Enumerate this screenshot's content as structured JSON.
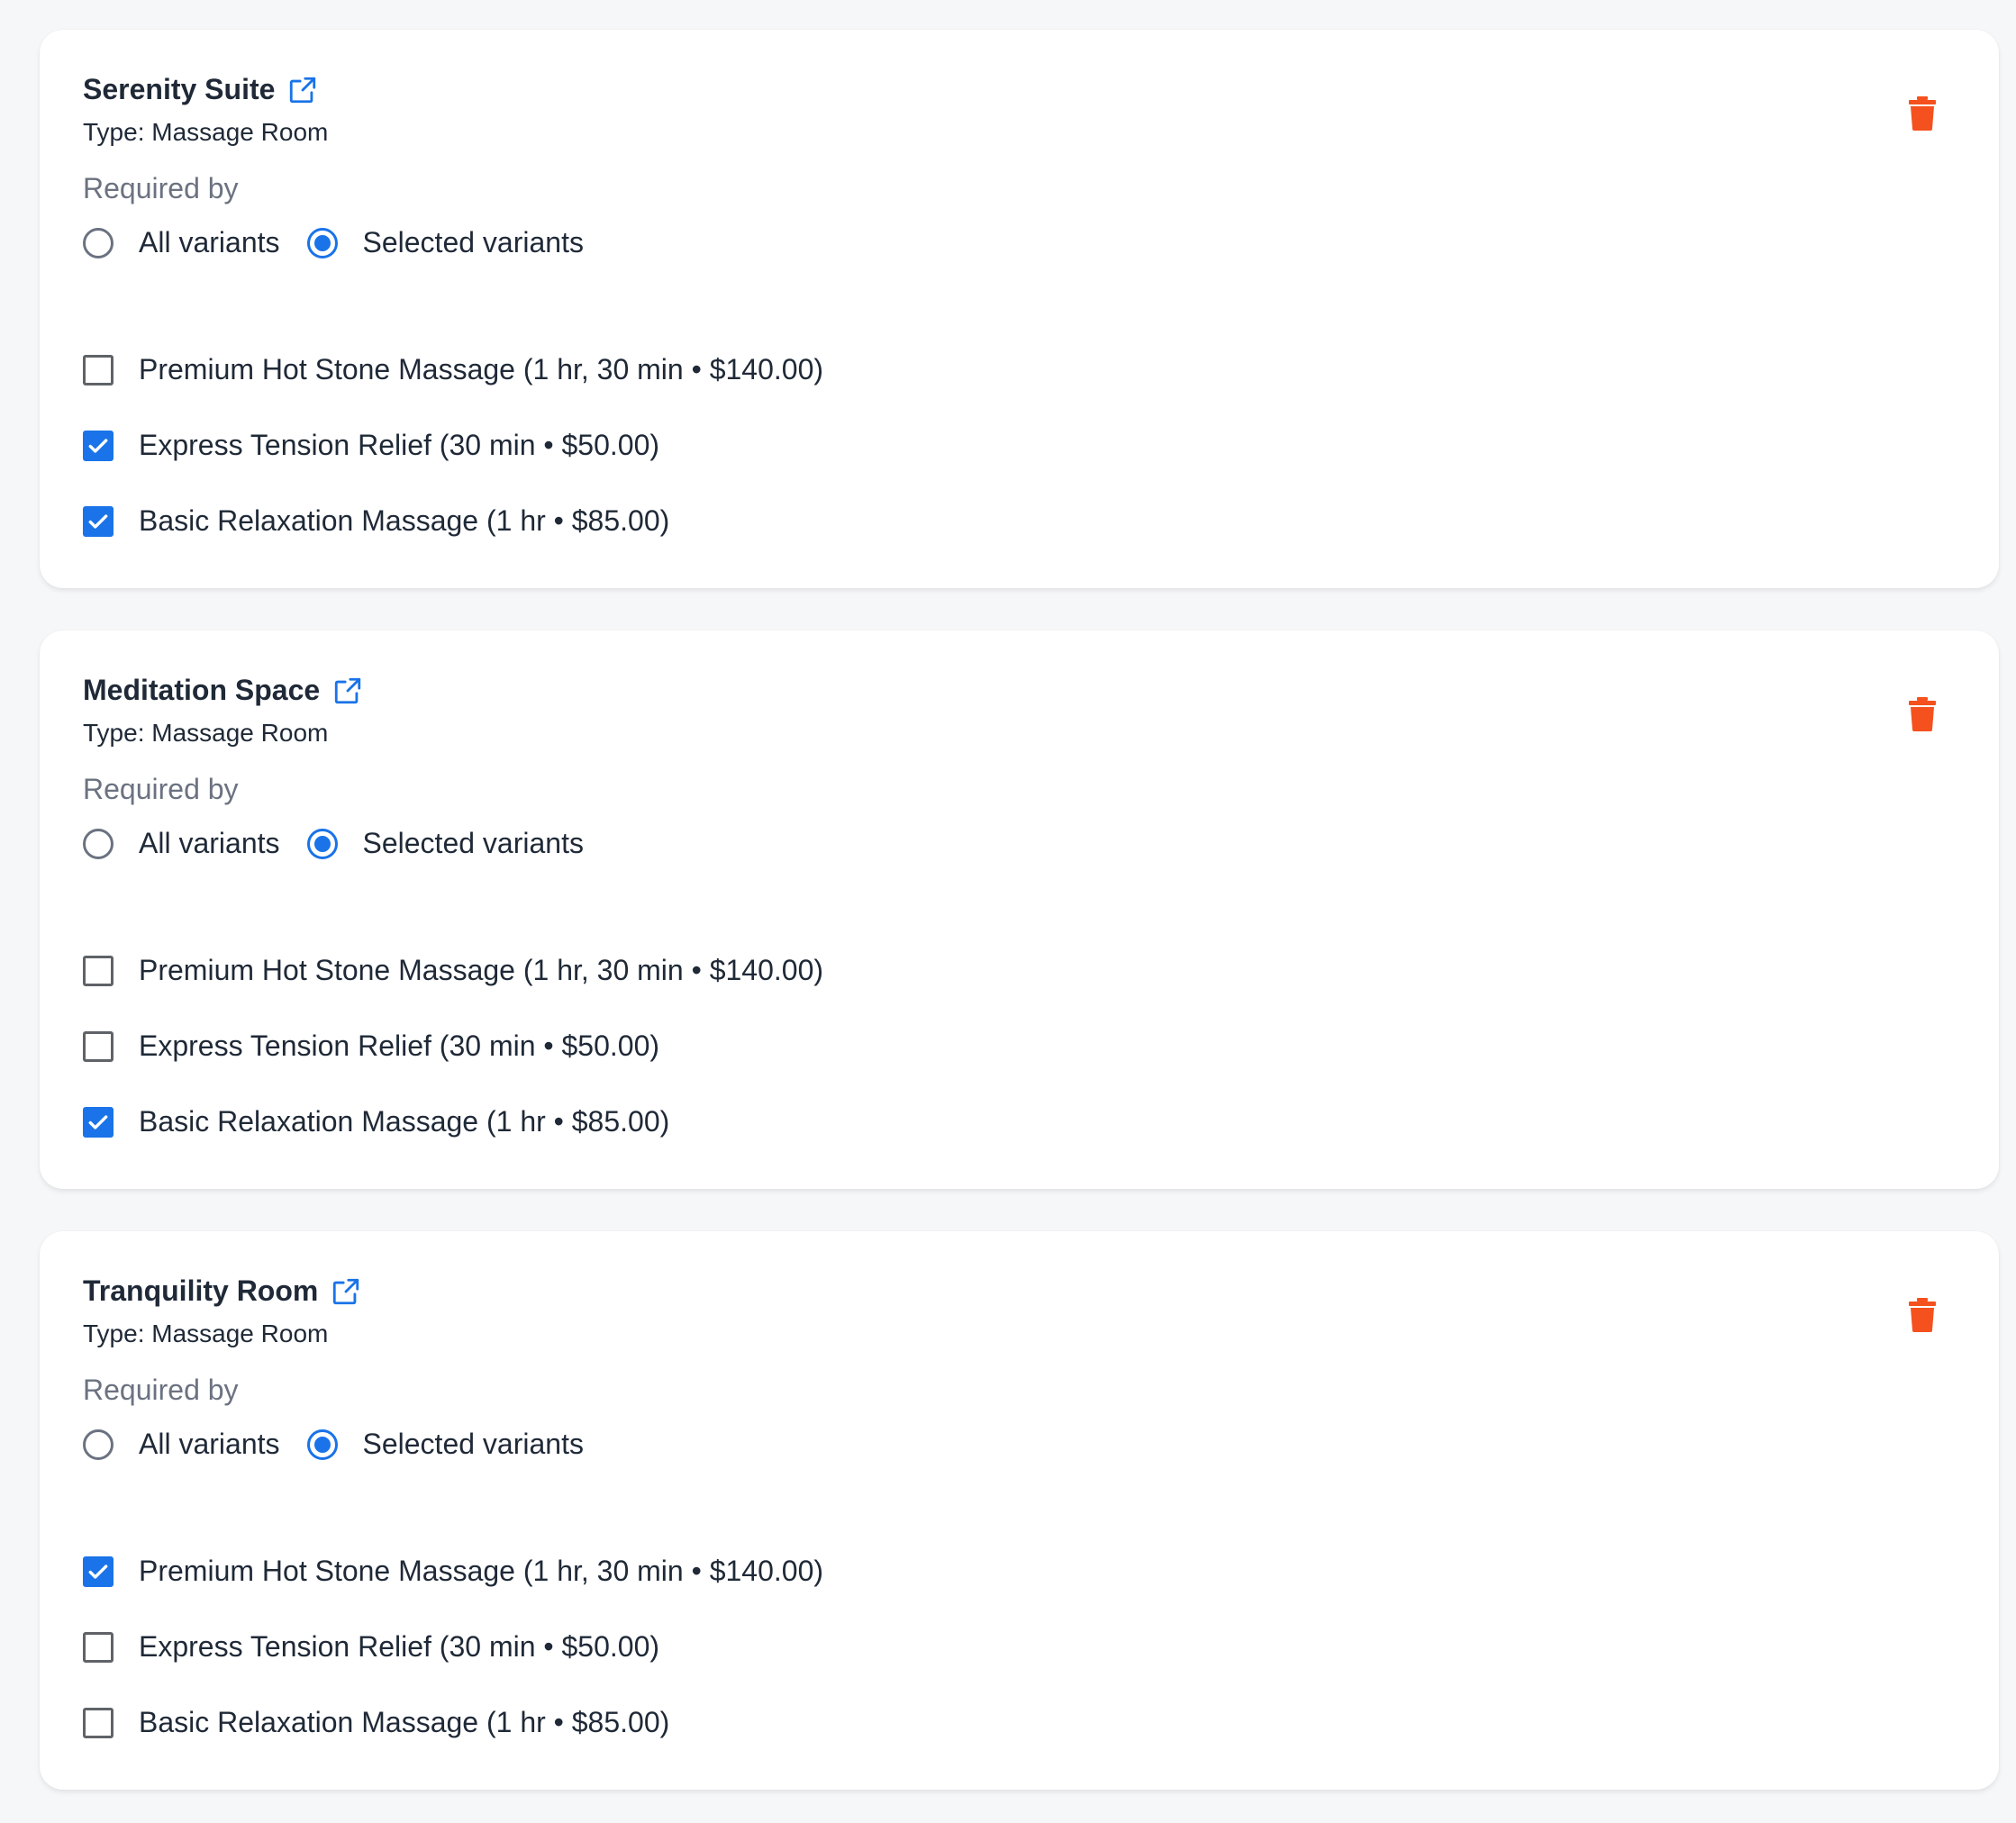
{
  "colors": {
    "accent": "#1a73e8",
    "delete": "#f4511e",
    "muted_text": "#6b7280",
    "text": "#1f2937"
  },
  "icons": {
    "open_link": "external-link-icon",
    "delete": "trash-icon"
  },
  "resources": [
    {
      "name": "Serenity Suite",
      "type_text": "Type: Massage Room",
      "required_by_label": "Required by",
      "radio_all": "All variants",
      "radio_selected": "Selected variants",
      "selected_option": "selected",
      "variants": [
        {
          "label": "Premium Hot Stone Massage (1 hr, 30 min • $140.00)",
          "checked": false
        },
        {
          "label": "Express Tension Relief (30 min • $50.00)",
          "checked": true
        },
        {
          "label": "Basic Relaxation Massage (1 hr • $85.00)",
          "checked": true
        }
      ]
    },
    {
      "name": "Meditation Space",
      "type_text": "Type: Massage Room",
      "required_by_label": "Required by",
      "radio_all": "All variants",
      "radio_selected": "Selected variants",
      "selected_option": "selected",
      "variants": [
        {
          "label": "Premium Hot Stone Massage (1 hr, 30 min • $140.00)",
          "checked": false
        },
        {
          "label": "Express Tension Relief (30 min • $50.00)",
          "checked": false
        },
        {
          "label": "Basic Relaxation Massage (1 hr • $85.00)",
          "checked": true
        }
      ]
    },
    {
      "name": "Tranquility Room",
      "type_text": "Type: Massage Room",
      "required_by_label": "Required by",
      "radio_all": "All variants",
      "radio_selected": "Selected variants",
      "selected_option": "selected",
      "variants": [
        {
          "label": "Premium Hot Stone Massage (1 hr, 30 min • $140.00)",
          "checked": true
        },
        {
          "label": "Express Tension Relief (30 min • $50.00)",
          "checked": false
        },
        {
          "label": "Basic Relaxation Massage (1 hr • $85.00)",
          "checked": false
        }
      ]
    }
  ]
}
